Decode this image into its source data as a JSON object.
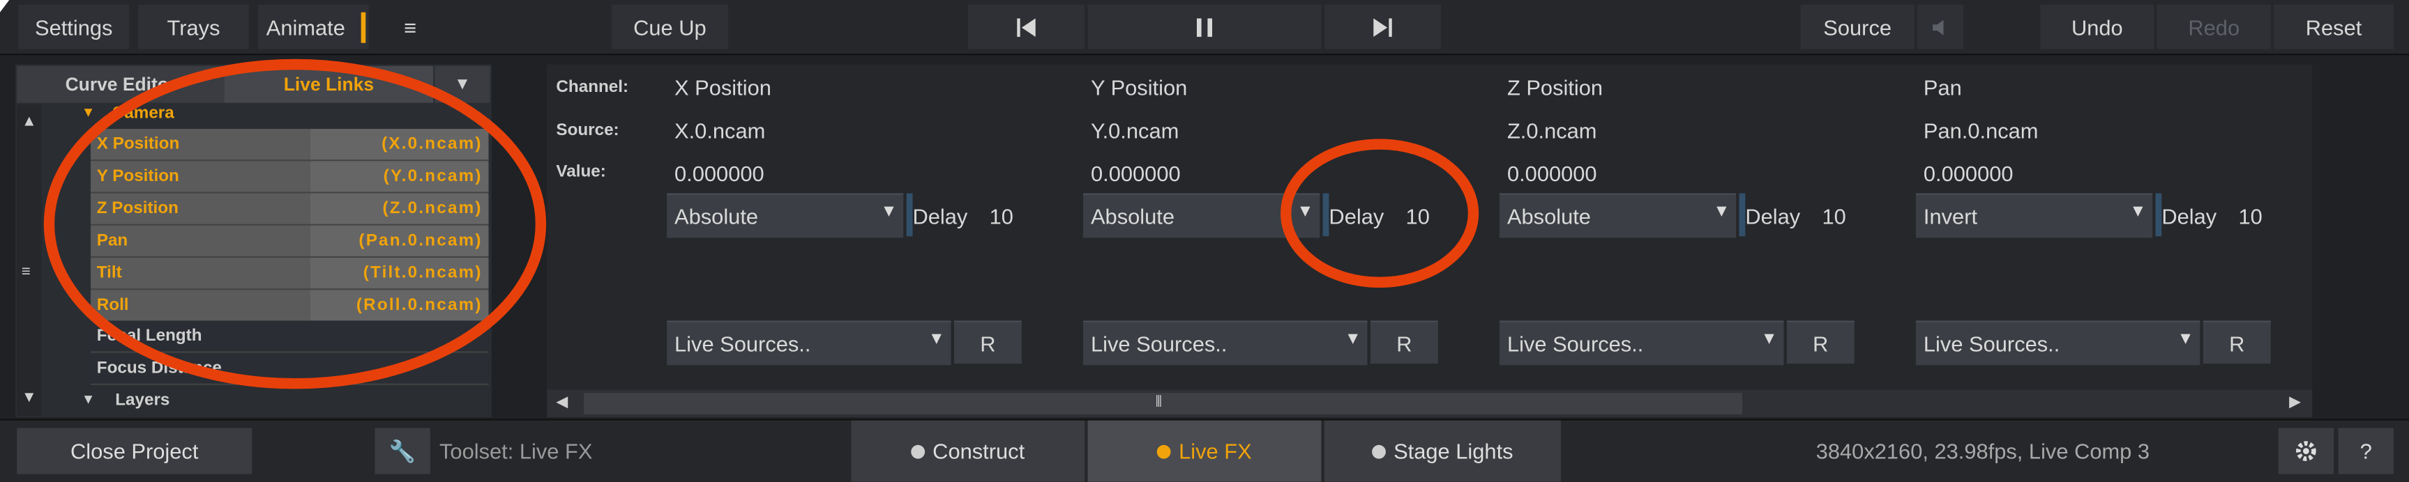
{
  "toolbar": {
    "settings": "Settings",
    "trays": "Trays",
    "animate": "Animate",
    "cue_up": "Cue Up",
    "source": "Source",
    "undo": "Undo",
    "redo": "Redo",
    "reset": "Reset"
  },
  "left_panel": {
    "tab_curve": "Curve Editor",
    "tab_live": "Live Links",
    "camera_group": "Camera",
    "rows": [
      {
        "name": "X Position",
        "value": "(X.0.ncam)"
      },
      {
        "name": "Y Position",
        "value": "(Y.0.ncam)"
      },
      {
        "name": "Z Position",
        "value": "(Z.0.ncam)"
      },
      {
        "name": "Pan",
        "value": "(Pan.0.ncam)"
      },
      {
        "name": "Tilt",
        "value": "(Tilt.0.ncam)"
      },
      {
        "name": "Roll",
        "value": "(Roll.0.ncam)"
      }
    ],
    "focal": "Focal Length",
    "focus": "Focus Distance",
    "layers": "Layers"
  },
  "right_panel": {
    "channel_label": "Channel:",
    "source_label": "Source:",
    "value_label": "Value:",
    "delay_label": "Delay",
    "live_sources": "Live Sources..",
    "r_label": "R",
    "channels": [
      {
        "channel": "X Position",
        "source": "X.0.ncam",
        "value": "0.000000",
        "mode": "Absolute",
        "delay": "10"
      },
      {
        "channel": "Y Position",
        "source": "Y.0.ncam",
        "value": "0.000000",
        "mode": "Absolute",
        "delay": "10"
      },
      {
        "channel": "Z Position",
        "source": "Z.0.ncam",
        "value": "0.000000",
        "mode": "Absolute",
        "delay": "10"
      },
      {
        "channel": "Pan",
        "source": "Pan.0.ncam",
        "value": "0.000000",
        "mode": "Invert",
        "delay": "10"
      }
    ]
  },
  "bottom": {
    "close_project": "Close Project",
    "toolset": "Toolset: Live FX",
    "tab_construct": "Construct",
    "tab_livefx": "Live FX",
    "tab_stage": "Stage Lights",
    "status": "3840x2160, 23.98fps, Live Comp 3",
    "help": "?"
  },
  "colors": {
    "accent": "#f0a30a",
    "annotation": "#e8400a"
  }
}
